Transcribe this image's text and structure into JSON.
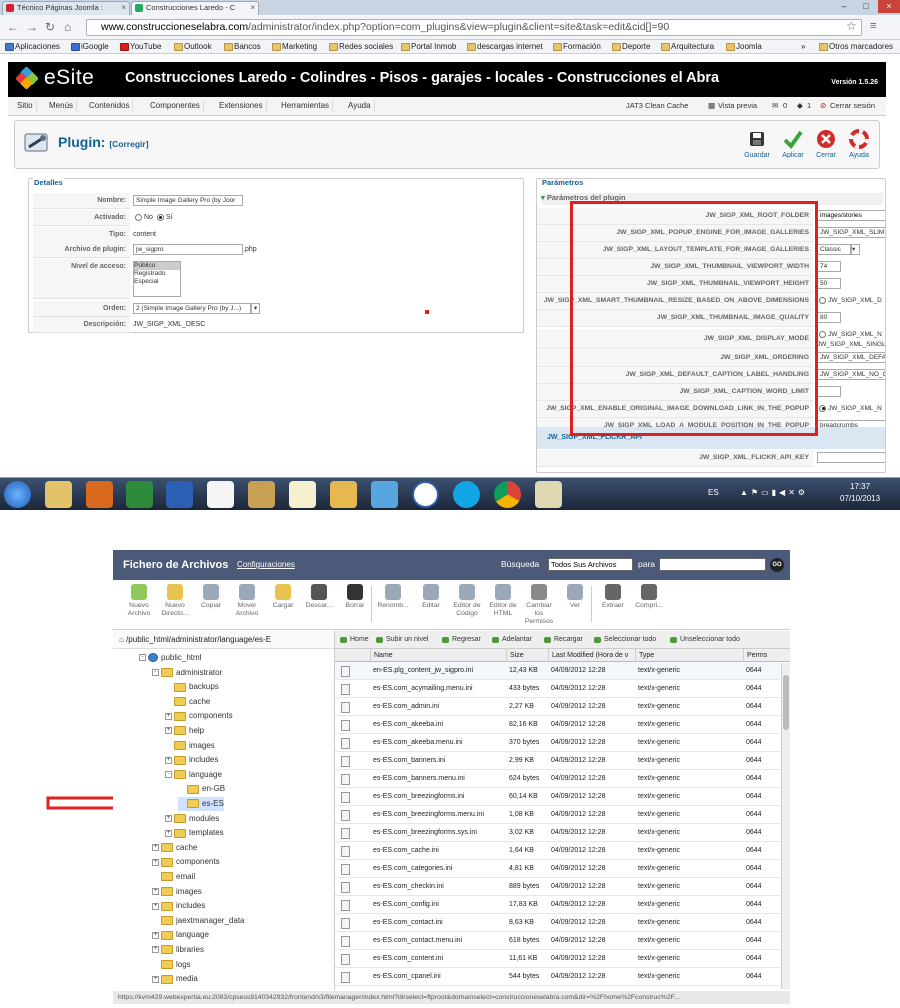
{
  "browser": {
    "tabs": [
      {
        "label": "Técnico Páginas Joomla :"
      },
      {
        "label": "Construcciones Laredo - C"
      }
    ],
    "url_prefix": "www.construccioneselabra.com",
    "url_rest": "/administrator/index.php?option=com_plugins&view=plugin&client=site&task=edit&cid[]=90",
    "bookmarks": [
      "Aplicaciones",
      "iGoogle",
      "YouTube",
      "Outlook",
      "Bancos",
      "Marketing",
      "Redes sociales",
      "Portal Inmob",
      "descargas internet",
      "Formación",
      "Deporte",
      "Arquitectura",
      "Joomla"
    ],
    "bookmarks_more": "»",
    "other_bookmarks": "Otros marcadores"
  },
  "admin": {
    "logo": "eSite",
    "site_title": "Construcciones Laredo - Colindres - Pisos - garajes - locales - Construcciones el Abra",
    "version": "Versión 1.5.26",
    "menu": [
      "Sitio",
      "Menús",
      "Contenidos",
      "Componentes",
      "Extensiones",
      "Herramientas",
      "Ayuda"
    ],
    "status": {
      "cache": "JAT3 Clean Cache",
      "preview": "Vista previa",
      "msgs": "0",
      "users": "1",
      "logout": "Cerrar sesión"
    },
    "page_title": "Plugin:",
    "page_subtitle": "[Corregir]",
    "toolbar": {
      "save": "Guardar",
      "apply": "Aplicar",
      "close": "Cerrar",
      "help": "Ayuda"
    },
    "details": {
      "legend": "Detalles",
      "name_label": "Nombre:",
      "name_value": "Simple Image Gallery Pro (by Joor",
      "enabled_label": "Activado:",
      "enabled_no": "No",
      "enabled_yes": "Sí",
      "type_label": "Tipo:",
      "type_value": "content",
      "file_label": "Archivo de plugin:",
      "file_value": "jw_sigpro",
      "file_ext": ".php",
      "access_label": "Nivel de acceso:",
      "access_options": [
        "Público",
        "Registrado",
        "Especial"
      ],
      "order_label": "Orden:",
      "order_value": "2 (Simple Image Gallery Pro (by J...)",
      "desc_label": "Descripción:",
      "desc_value": "JW_SIGP_XML_DESC"
    },
    "params": {
      "legend": "Parámetros",
      "section": "Parámetros del plugin",
      "rows": [
        {
          "key": "JW_SIGP_XML_ROOT_FOLDER",
          "val": "images/stories"
        },
        {
          "key": "JW_SIGP_XML_POPUP_ENGINE_FOR_IMAGE_GALLERIES",
          "val": "JW_SIGP_XML_SLIM"
        },
        {
          "key": "JW_SIGP_XML_LAYOUT_TEMPLATE_FOR_IMAGE_GALLERIES",
          "val": "Classic"
        },
        {
          "key": "JW_SIGP_XML_THUMBNAIL_VIEWPORT_WIDTH",
          "val": "74"
        },
        {
          "key": "JW_SIGP_XML_THUMBNAIL_VIEWPORT_HEIGHT",
          "val": "50"
        },
        {
          "key": "JW_SIGP_XML_SMART_THUMBNAIL_RESIZE_BASED_ON_ABOVE_DIMENSIONS",
          "val": "JW_SIGP_XML_D"
        },
        {
          "key": "JW_SIGP_XML_THUMBNAIL_IMAGE_QUALITY",
          "val": "80"
        },
        {
          "key": "JW_SIGP_XML_DISPLAY_MODE",
          "val": "JW_SIGP_XML_N",
          "val2": "JW_SIGP_XML_SINGL"
        },
        {
          "key": "JW_SIGP_XML_ORDERING",
          "val": "JW_SIGP_XML_DEFA"
        },
        {
          "key": "JW_SIGP_XML_DEFAULT_CAPTION_LABEL_HANDLING",
          "val": "JW_SIGP_XML_NO_C"
        },
        {
          "key": "JW_SIGP_XML_CAPTION_WORD_LIMIT",
          "val": ""
        },
        {
          "key": "JW_SIGP_XML_ENABLE_ORIGINAL_IMAGE_DOWNLOAD_LINK_IN_THE_POPUP",
          "val": "JW_SIGP_XML_N"
        },
        {
          "key": "JW_SIGP_XML_LOAD_A_MODULE_POSITION_IN_THE_POPUP",
          "val": "breadcrumbs"
        }
      ],
      "section2": "JW_SIGP_XML_FLICKR_API",
      "flickr_key": "JW_SIGP_XML_FLICKR_API_KEY"
    }
  },
  "taskbar": {
    "lang": "ES",
    "time": "17:37",
    "date": "07/10/2013"
  },
  "filemanager": {
    "title": "Fichero de Archivos",
    "config": "Configuraciones",
    "search_label": "Búsqueda",
    "search_scope": "Todos Sus Archivos",
    "search_for": "para",
    "go": "GO",
    "tools": [
      [
        "Nuevo",
        "Archivo"
      ],
      [
        "Nuevo",
        "Directo..."
      ],
      [
        "Copiar",
        ""
      ],
      [
        "Mover",
        "Archivo"
      ],
      [
        "Cargar",
        ""
      ],
      [
        "Descar...",
        ""
      ],
      [
        "Borrar",
        ""
      ],
      [
        "Renomb...",
        ""
      ],
      [
        "Editar",
        ""
      ],
      [
        "Editor de",
        "Código"
      ],
      [
        "Editor de",
        "HTML"
      ],
      [
        "Cambiar los",
        "Permisos"
      ],
      [
        "Ver",
        ""
      ],
      [
        "Extraer",
        ""
      ],
      [
        "Compri...",
        ""
      ]
    ],
    "path": "/public_html/administrator/language/es-E",
    "nav": [
      "Home",
      "Subir un nivel",
      "Regresar",
      "Adelantar",
      "Recargar",
      "Seleccionar todo",
      "Unseleccionar todo"
    ],
    "tree": [
      {
        "label": "public_html",
        "level": 0,
        "exp": "-"
      },
      {
        "label": "administrator",
        "level": 1,
        "exp": "-"
      },
      {
        "label": "backups",
        "level": 2,
        "exp": ""
      },
      {
        "label": "cache",
        "level": 2,
        "exp": ""
      },
      {
        "label": "components",
        "level": 2,
        "exp": "+"
      },
      {
        "label": "help",
        "level": 2,
        "exp": "+"
      },
      {
        "label": "images",
        "level": 2,
        "exp": ""
      },
      {
        "label": "includes",
        "level": 2,
        "exp": "+"
      },
      {
        "label": "language",
        "level": 2,
        "exp": "-"
      },
      {
        "label": "en-GB",
        "level": 3,
        "exp": ""
      },
      {
        "label": "es-ES",
        "level": 3,
        "exp": "",
        "sel": true
      },
      {
        "label": "modules",
        "level": 2,
        "exp": "+"
      },
      {
        "label": "templates",
        "level": 2,
        "exp": "+"
      },
      {
        "label": "cache",
        "level": 1,
        "exp": "+"
      },
      {
        "label": "components",
        "level": 1,
        "exp": "+"
      },
      {
        "label": "email",
        "level": 1,
        "exp": ""
      },
      {
        "label": "images",
        "level": 1,
        "exp": "+"
      },
      {
        "label": "includes",
        "level": 1,
        "exp": "+"
      },
      {
        "label": "jaextmanager_data",
        "level": 1,
        "exp": ""
      },
      {
        "label": "language",
        "level": 1,
        "exp": "+"
      },
      {
        "label": "libraries",
        "level": 1,
        "exp": "+"
      },
      {
        "label": "logs",
        "level": 1,
        "exp": ""
      },
      {
        "label": "media",
        "level": 1,
        "exp": "+"
      }
    ],
    "columns": [
      "Name",
      "Size",
      "Last Modified (Hora de v",
      "Type",
      "Perms"
    ],
    "files": [
      [
        "en-ES.plg_content_jw_sigpro.ini",
        "12,43 KB",
        "04/09/2012 12:28",
        "text/x-generic",
        "0644"
      ],
      [
        "es-ES.com_acymailing.menu.ini",
        "433 bytes",
        "04/09/2012 12:28",
        "text/x-generic",
        "0644"
      ],
      [
        "es-ES.com_admin.ini",
        "2,27 KB",
        "04/09/2012 12:28",
        "text/x-generic",
        "0644"
      ],
      [
        "es-ES.com_akeeba.ini",
        "82,16 KB",
        "04/09/2012 12:28",
        "text/x-generic",
        "0644"
      ],
      [
        "es-ES.com_akeeba.menu.ini",
        "370 bytes",
        "04/09/2012 12:28",
        "text/x-generic",
        "0644"
      ],
      [
        "es-ES.com_banners.ini",
        "2,99 KB",
        "04/09/2012 12:28",
        "text/x-generic",
        "0644"
      ],
      [
        "es-ES.com_banners.menu.ini",
        "624 bytes",
        "04/09/2012 12:28",
        "text/x-generic",
        "0644"
      ],
      [
        "es-ES.com_breezingforms.ini",
        "60,14 KB",
        "04/09/2012 12:28",
        "text/x-generic",
        "0644"
      ],
      [
        "es-ES.com_breezingforms.menu.ini",
        "1,08 KB",
        "04/09/2012 12:28",
        "text/x-generic",
        "0644"
      ],
      [
        "es-ES.com_breezingforms.sys.ini",
        "3,02 KB",
        "04/09/2012 12:28",
        "text/x-generic",
        "0644"
      ],
      [
        "es-ES.com_cache.ini",
        "1,64 KB",
        "04/09/2012 12:28",
        "text/x-generic",
        "0644"
      ],
      [
        "es-ES.com_categories.ini",
        "4,81 KB",
        "04/09/2012 12:28",
        "text/x-generic",
        "0644"
      ],
      [
        "es-ES.com_checkin.ini",
        "889 bytes",
        "04/09/2012 12:28",
        "text/x-generic",
        "0644"
      ],
      [
        "es-ES.com_config.ini",
        "17,83 KB",
        "04/09/2012 12:28",
        "text/x-generic",
        "0644"
      ],
      [
        "es-ES.com_contact.ini",
        "8,63 KB",
        "04/09/2012 12:28",
        "text/x-generic",
        "0644"
      ],
      [
        "es-ES.com_contact.menu.ini",
        "618 bytes",
        "04/09/2012 12:28",
        "text/x-generic",
        "0644"
      ],
      [
        "es-ES.com_content.ini",
        "11,61 KB",
        "04/09/2012 12:28",
        "text/x-generic",
        "0644"
      ],
      [
        "es-ES.com_cpanel.ini",
        "544 bytes",
        "04/09/2012 12:28",
        "text/x-generic",
        "0644"
      ]
    ],
    "status_url": "https://kvm429.webexpertia.eu:2083/cpsess9140342932/frontend/x3/filemanager/index.html?dirselect=ftproot&domainselect=construccioneselabra.com&dir=%2Fhome%2Fconstruc%2F..."
  }
}
